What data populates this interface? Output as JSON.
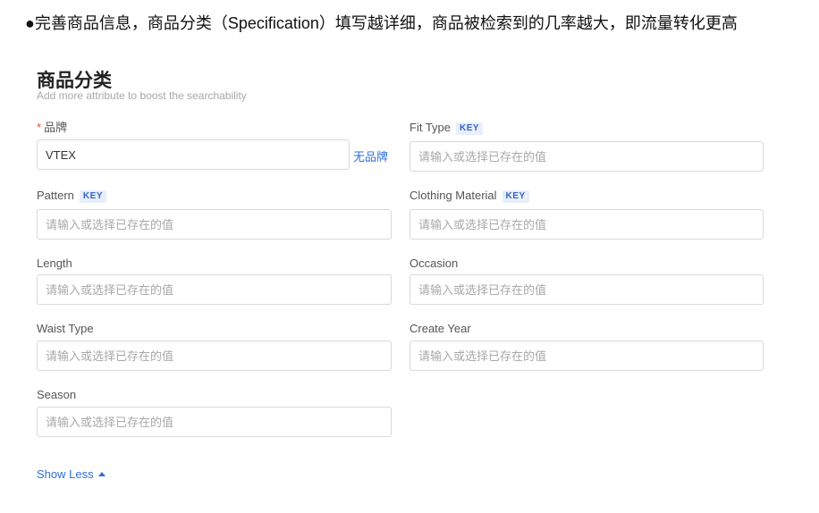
{
  "tip": "●完善商品信息，商品分类（Specification）填写越详细，商品被检索到的几率越大，即流量转化更高",
  "section": {
    "title": "商品分类",
    "subtitle": "Add more attribute to boost the searchability"
  },
  "key_badge": "KEY",
  "required_mark": "*",
  "placeholder": "请输入或选择已存在的值",
  "fields": {
    "brand": {
      "label": "品牌",
      "value": "VTEX",
      "link": "无品牌"
    },
    "fit_type": {
      "label": "Fit Type"
    },
    "pattern": {
      "label": "Pattern"
    },
    "clothing_material": {
      "label": "Clothing Material"
    },
    "length": {
      "label": "Length"
    },
    "occasion": {
      "label": "Occasion"
    },
    "waist_type": {
      "label": "Waist Type"
    },
    "create_year": {
      "label": "Create Year"
    },
    "season": {
      "label": "Season"
    }
  },
  "show_less": "Show Less",
  "colors": {
    "link": "#2f6fd6",
    "required": "#ee4d2d",
    "key_bg": "#e8eefb",
    "border": "#d9d9d9"
  }
}
